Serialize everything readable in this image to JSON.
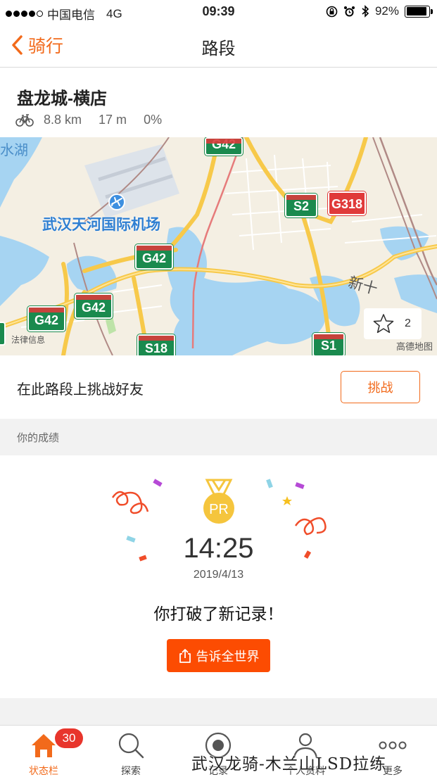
{
  "status_bar": {
    "carrier": "中国电信",
    "network": "4G",
    "time": "09:39",
    "battery": "92%",
    "battery_level": 0.92
  },
  "nav": {
    "back_label": "骑行",
    "title": "路段"
  },
  "segment": {
    "name": "盘龙城-横店",
    "distance": "8.8 km",
    "elevation": "17 m",
    "grade": "0%"
  },
  "map": {
    "labels": {
      "airport": "武汉天河国际机场",
      "lake": "水湖",
      "new": "新十",
      "legal": "法律信息",
      "credit": "高德地图"
    },
    "road_shields": [
      {
        "text": "G42",
        "color": "#1a8a4e"
      },
      {
        "text": "S2",
        "color": "#1a8a4e"
      },
      {
        "text": "G318",
        "color": "#e03a3a"
      },
      {
        "text": "G42",
        "color": "#1a8a4e"
      },
      {
        "text": "G42",
        "color": "#1a8a4e"
      },
      {
        "text": "G42",
        "color": "#1a8a4e"
      },
      {
        "text": "S18",
        "color": "#1a8a4e"
      },
      {
        "text": "S1",
        "color": "#1a8a4e"
      }
    ],
    "star_count": "2"
  },
  "challenge": {
    "text": "在此路段上挑战好友",
    "button": "挑战"
  },
  "results": {
    "section_label": "你的成绩",
    "badge": "PR",
    "time": "14:25",
    "date": "2019/4/13",
    "message": "你打破了新记录！",
    "share_button": "告诉全世界"
  },
  "tabbar": {
    "items": [
      {
        "label": "状态栏",
        "icon": "home-icon",
        "badge": "30"
      },
      {
        "label": "探索",
        "icon": "search-icon"
      },
      {
        "label": "记录",
        "icon": "record-icon"
      },
      {
        "label": "个人资料",
        "icon": "profile-icon"
      },
      {
        "label": "更多",
        "icon": "more-icon"
      }
    ]
  },
  "watermark": "武汉龙骑-木兰山LSD拉练",
  "colors": {
    "accent": "#f26a1b",
    "share": "#fc4c02",
    "water": "#a6d4f2",
    "road": "#f7c94a"
  }
}
